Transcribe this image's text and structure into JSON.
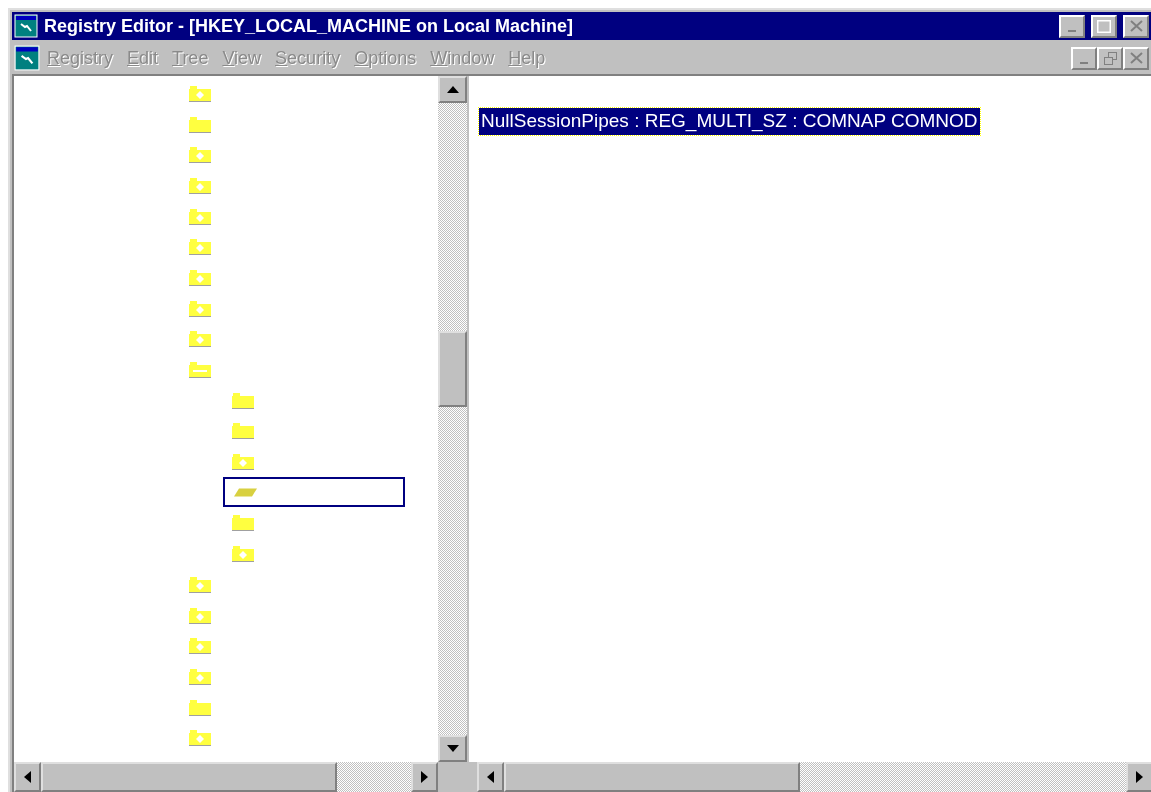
{
  "window": {
    "title": "Registry Editor - [HKEY_LOCAL_MACHINE on Local Machine]"
  },
  "menu": [
    {
      "label": "Registry",
      "disabled": true
    },
    {
      "label": "Edit",
      "disabled": true
    },
    {
      "label": "Tree",
      "disabled": true
    },
    {
      "label": "View",
      "disabled": true
    },
    {
      "label": "Security",
      "disabled": true
    },
    {
      "label": "Options",
      "disabled": true
    },
    {
      "label": "Window",
      "disabled": true
    },
    {
      "label": "Help",
      "disabled": true
    }
  ],
  "tree": [
    {
      "kind": "plus",
      "selected": false
    },
    {
      "kind": "plain",
      "selected": false
    },
    {
      "kind": "plus",
      "selected": false
    },
    {
      "kind": "plus",
      "selected": false
    },
    {
      "kind": "plus",
      "selected": false
    },
    {
      "kind": "plus",
      "selected": false
    },
    {
      "kind": "plus",
      "selected": false
    },
    {
      "kind": "plus",
      "selected": false
    },
    {
      "kind": "plus",
      "selected": false
    },
    {
      "kind": "minus",
      "selected": false,
      "children": [
        {
          "kind": "plain",
          "selected": false
        },
        {
          "kind": "plain",
          "selected": false
        },
        {
          "kind": "plus",
          "selected": false
        },
        {
          "kind": "open",
          "selected": true
        },
        {
          "kind": "plain",
          "selected": false
        },
        {
          "kind": "plus",
          "selected": false
        }
      ]
    },
    {
      "kind": "plus",
      "selected": false
    },
    {
      "kind": "plus",
      "selected": false
    },
    {
      "kind": "plus",
      "selected": false
    },
    {
      "kind": "plus",
      "selected": false
    },
    {
      "kind": "plain",
      "selected": false
    },
    {
      "kind": "plus",
      "selected": false
    }
  ],
  "values": [
    {
      "text": "NullSessionPipes : REG_MULTI_SZ : COMNAP COMNOD",
      "selected": true
    }
  ]
}
